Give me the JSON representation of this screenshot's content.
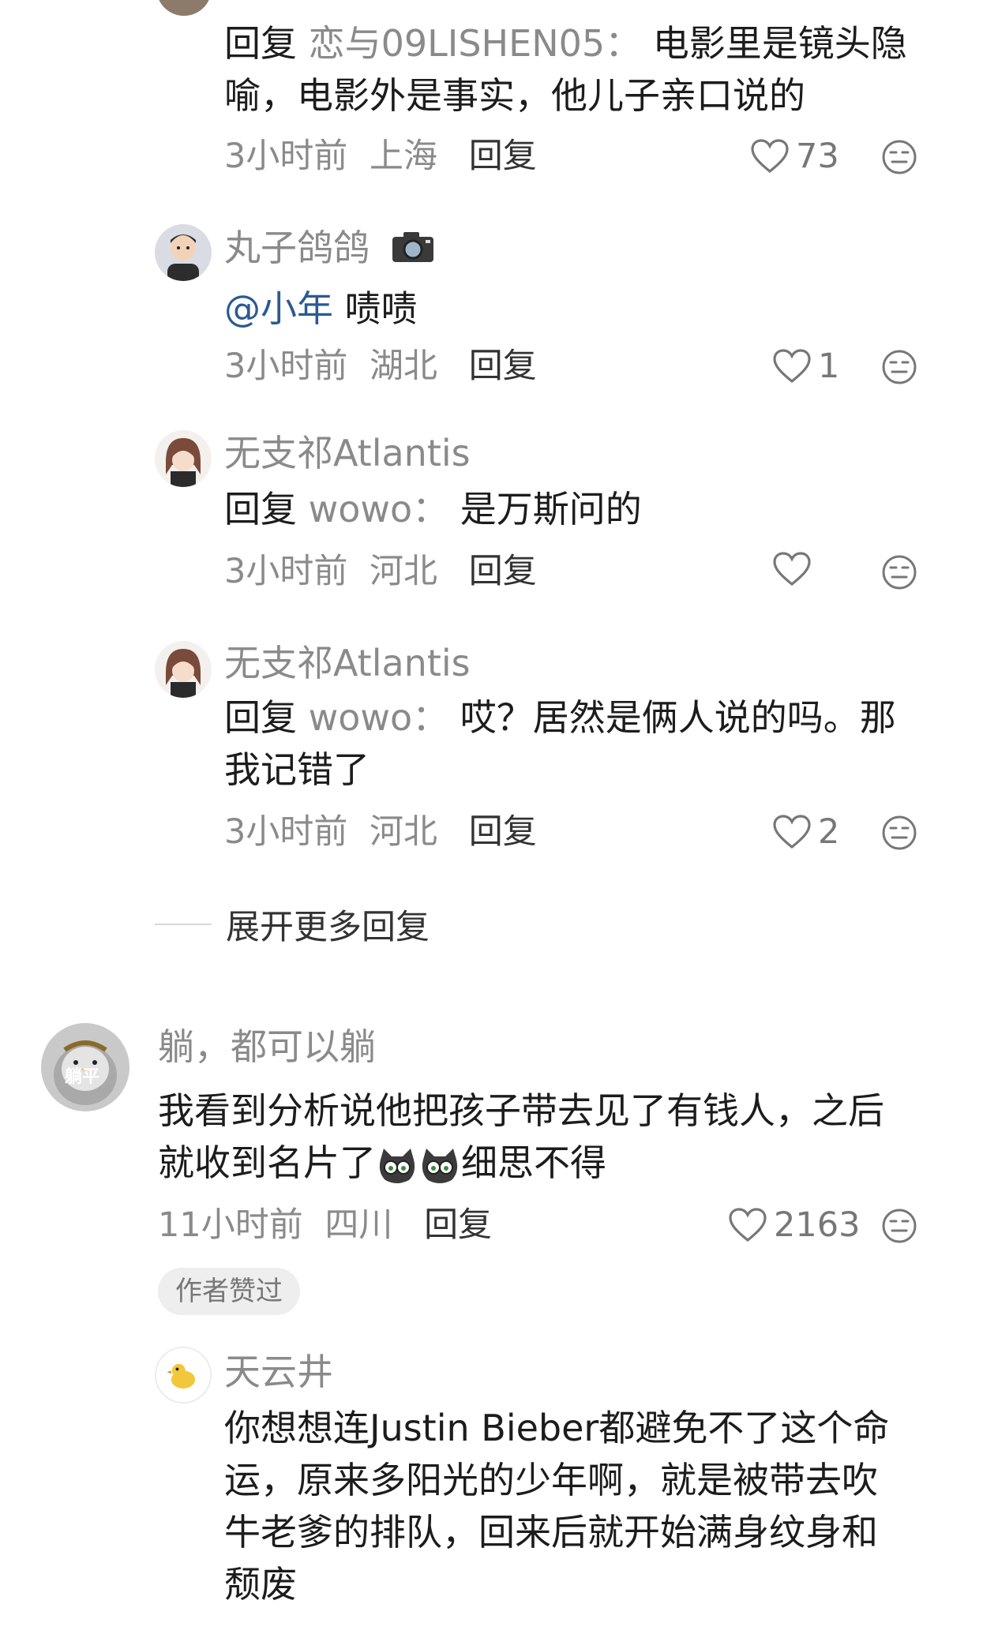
{
  "thread": {
    "c1": {
      "reply_kw": "回复",
      "reply_target": "恋与09LISHEN05：",
      "text_line1": "电影里是镜头隐",
      "text_line2": "喻，电影外是事实，他儿子亲口说的",
      "time": "3小时前",
      "location": "上海",
      "reply_label": "回复",
      "likes": "73"
    },
    "c2": {
      "user": "丸子鸽鸽",
      "user_icon": "camera-icon",
      "mention": "@小年",
      "text": " 啧啧",
      "time": "3小时前",
      "location": "湖北",
      "reply_label": "回复",
      "likes": "1"
    },
    "c3": {
      "user": "无支祁Atlantis",
      "reply_kw": "回复",
      "reply_target": "wowo：",
      "text": "是万斯问的",
      "time": "3小时前",
      "location": "河北",
      "reply_label": "回复",
      "likes": ""
    },
    "c4": {
      "user": "无支祁Atlantis",
      "reply_kw": "回复",
      "reply_target": "wowo：",
      "text_line1": "哎？居然是俩人说的吗。那",
      "text_line2": "我记错了",
      "time": "3小时前",
      "location": "河北",
      "reply_label": "回复",
      "likes": "2"
    },
    "expand_label": "展开更多回复"
  },
  "main_comment": {
    "user": "躺，都可以躺",
    "avatar_text": "躺平",
    "text_line1": "我看到分析说他把孩子带去见了有钱人，之后",
    "text_line2_a": "就收到名片了",
    "text_line2_b": "细思不得",
    "inline_emoji": "cat-emoji-icon",
    "time": "11小时前",
    "location": "四川",
    "reply_label": "回复",
    "likes": "2163",
    "badge": "作者赞过"
  },
  "sub_reply": {
    "user": "天云井",
    "text_line1": "你想想连Justin Bieber都避免不了这个命",
    "text_line2": "运，原来多阳光的少年啊，就是被带去吹",
    "text_line3": "牛老爹的排队，回来后就开始满身纹身和",
    "text_line4": "颓废"
  },
  "colors": {
    "mention": "#2b5a8f",
    "secondary_text": "#8a8a8a",
    "badge_bg": "#eeeeee"
  }
}
